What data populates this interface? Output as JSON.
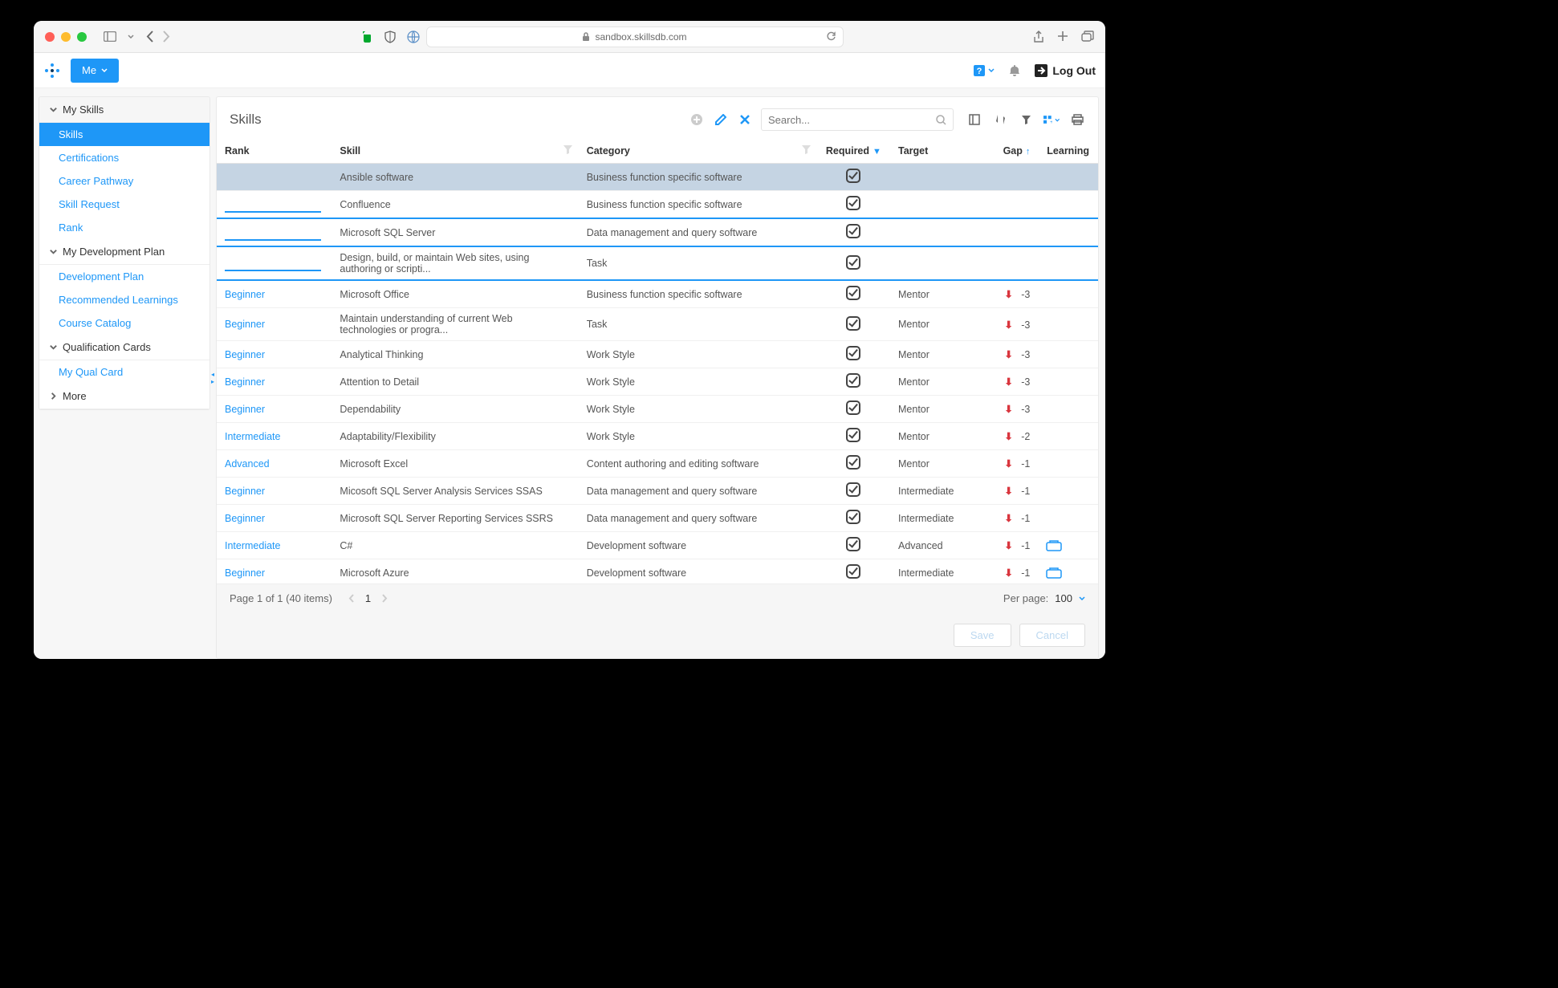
{
  "browser": {
    "url": "sandbox.skillsdb.com"
  },
  "header": {
    "me_label": "Me",
    "logout_label": "Log Out"
  },
  "sidebar": {
    "groups": [
      {
        "title": "My Skills",
        "items": [
          "Skills",
          "Certifications",
          "Career Pathway",
          "Skill Request",
          "Rank"
        ],
        "active": 0
      },
      {
        "title": "My Development Plan",
        "items": [
          "Development Plan",
          "Recommended Learnings",
          "Course Catalog"
        ]
      },
      {
        "title": "Qualification Cards",
        "items": [
          "My Qual Card"
        ]
      },
      {
        "title": "More",
        "items": [],
        "collapsed": true
      }
    ]
  },
  "panel": {
    "title": "Skills",
    "search_placeholder": "Search..."
  },
  "table": {
    "columns": [
      "Rank",
      "Skill",
      "Category",
      "Required",
      "Target",
      "Gap",
      "Learning"
    ],
    "rows": [
      {
        "rank": "",
        "skill": "Ansible software",
        "cat": "Business function specific software",
        "req": true,
        "target": "",
        "gap": "",
        "learn": "",
        "hl": true
      },
      {
        "rank": "",
        "skill": "Confluence",
        "cat": "Business function specific software",
        "req": true,
        "target": "",
        "gap": "",
        "learn": "",
        "edit": true
      },
      {
        "rank": "",
        "skill": "Microsoft SQL Server",
        "cat": "Data management and query software",
        "req": true,
        "target": "",
        "gap": "",
        "learn": "",
        "edit": true
      },
      {
        "rank": "",
        "skill": "Design, build, or maintain Web sites, using authoring or scripti...",
        "cat": "Task",
        "req": true,
        "target": "",
        "gap": "",
        "learn": "",
        "edit": true
      },
      {
        "rank": "Beginner",
        "skill": "Microsoft Office",
        "cat": "Business function specific software",
        "req": true,
        "target": "Mentor",
        "gap": "-3",
        "learn": ""
      },
      {
        "rank": "Beginner",
        "skill": "Maintain understanding of current Web technologies or progra...",
        "cat": "Task",
        "req": true,
        "target": "Mentor",
        "gap": "-3",
        "learn": ""
      },
      {
        "rank": "Beginner",
        "skill": "Analytical Thinking",
        "cat": "Work Style",
        "req": true,
        "target": "Mentor",
        "gap": "-3",
        "learn": ""
      },
      {
        "rank": "Beginner",
        "skill": "Attention to Detail",
        "cat": "Work Style",
        "req": true,
        "target": "Mentor",
        "gap": "-3",
        "learn": ""
      },
      {
        "rank": "Beginner",
        "skill": "Dependability",
        "cat": "Work Style",
        "req": true,
        "target": "Mentor",
        "gap": "-3",
        "learn": ""
      },
      {
        "rank": "Intermediate",
        "skill": "Adaptability/Flexibility",
        "cat": "Work Style",
        "req": true,
        "target": "Mentor",
        "gap": "-2",
        "learn": ""
      },
      {
        "rank": "Advanced",
        "skill": "Microsoft Excel",
        "cat": "Content authoring and editing software",
        "req": true,
        "target": "Mentor",
        "gap": "-1",
        "learn": ""
      },
      {
        "rank": "Beginner",
        "skill": "Micosoft SQL Server Analysis Services SSAS",
        "cat": "Data management and query software",
        "req": true,
        "target": "Intermediate",
        "gap": "-1",
        "learn": ""
      },
      {
        "rank": "Beginner",
        "skill": "Microsoft SQL Server Reporting Services SSRS",
        "cat": "Data management and query software",
        "req": true,
        "target": "Intermediate",
        "gap": "-1",
        "learn": ""
      },
      {
        "rank": "Intermediate",
        "skill": "C#",
        "cat": "Development software",
        "req": true,
        "target": "Advanced",
        "gap": "-1",
        "learn": "yes"
      },
      {
        "rank": "Beginner",
        "skill": "Microsoft Azure",
        "cat": "Development software",
        "req": true,
        "target": "Intermediate",
        "gap": "-1",
        "learn": "yes"
      }
    ]
  },
  "pager": {
    "summary": "Page 1 of 1 (40 items)",
    "page": "1",
    "per_page_label": "Per page:",
    "per_page_value": "100"
  },
  "actions": {
    "save": "Save",
    "cancel": "Cancel"
  }
}
